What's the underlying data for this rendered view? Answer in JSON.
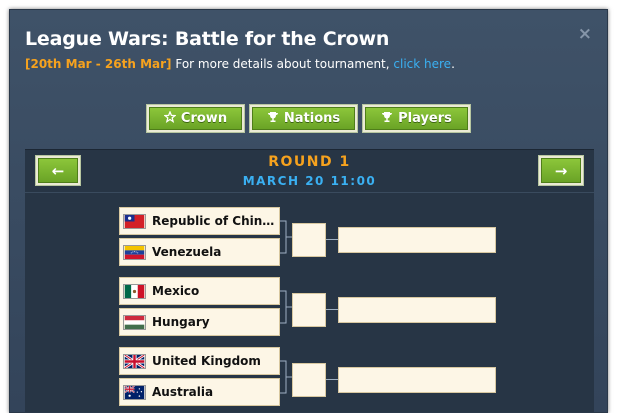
{
  "modal": {
    "title": "League Wars: Battle for the Crown",
    "close_glyph": "×",
    "dates": "[20th Mar - 26th Mar]",
    "details_text": " For more details about tournament, ",
    "details_link": "click here",
    "details_end": "."
  },
  "tabs": [
    {
      "label": "Crown",
      "icon": "star-icon"
    },
    {
      "label": "Nations",
      "icon": "trophy-icon"
    },
    {
      "label": "Players",
      "icon": "trophy-icon"
    }
  ],
  "round": {
    "title": "ROUND 1",
    "date": "MARCH 20 11:00",
    "prev_glyph": "←",
    "next_glyph": "→"
  },
  "matches": [
    {
      "team1": "Republic of China (T...",
      "flag1": "roc-flag-icon",
      "team2": "Venezuela",
      "flag2": "venezuela-flag-icon"
    },
    {
      "team1": "Mexico",
      "flag1": "mexico-flag-icon",
      "team2": "Hungary",
      "flag2": "hungary-flag-icon"
    },
    {
      "team1": "United Kingdom",
      "flag1": "uk-flag-icon",
      "team2": "Australia",
      "flag2": "australia-flag-icon"
    }
  ],
  "colors": {
    "accent_orange": "#f6a21e",
    "accent_blue": "#3ab0f2",
    "button_green": "#7ab632",
    "panel_bg": "#273545"
  }
}
